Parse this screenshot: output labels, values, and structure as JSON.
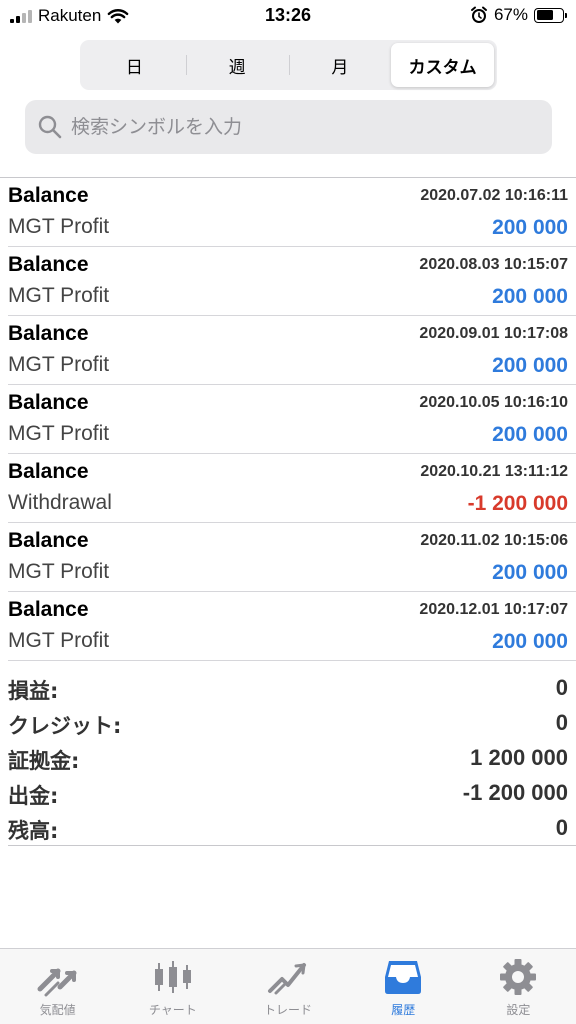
{
  "status_bar": {
    "carrier": "Rakuten",
    "time": "13:26",
    "battery_percent": "67%",
    "battery_level": 0.67
  },
  "period_tabs": [
    {
      "label": "日",
      "active": false
    },
    {
      "label": "週",
      "active": false
    },
    {
      "label": "月",
      "active": false
    },
    {
      "label": "カスタム",
      "active": true
    }
  ],
  "search": {
    "placeholder": "検索シンボルを入力",
    "value": ""
  },
  "deals": [
    {
      "type": "Balance",
      "time": "2020.07.02 10:16:11",
      "comment": "MGT Profit",
      "amount": "200 000",
      "sign": "positive"
    },
    {
      "type": "Balance",
      "time": "2020.08.03 10:15:07",
      "comment": "MGT Profit",
      "amount": "200 000",
      "sign": "positive"
    },
    {
      "type": "Balance",
      "time": "2020.09.01 10:17:08",
      "comment": "MGT Profit",
      "amount": "200 000",
      "sign": "positive"
    },
    {
      "type": "Balance",
      "time": "2020.10.05 10:16:10",
      "comment": "MGT Profit",
      "amount": "200 000",
      "sign": "positive"
    },
    {
      "type": "Balance",
      "time": "2020.10.21 13:11:12",
      "comment": "Withdrawal",
      "amount": "-1 200 000",
      "sign": "negative"
    },
    {
      "type": "Balance",
      "time": "2020.11.02 10:15:06",
      "comment": "MGT Profit",
      "amount": "200 000",
      "sign": "positive"
    },
    {
      "type": "Balance",
      "time": "2020.12.01 10:17:07",
      "comment": "MGT Profit",
      "amount": "200 000",
      "sign": "positive"
    }
  ],
  "summary": [
    {
      "label": "損益:",
      "value": "0"
    },
    {
      "label": "クレジット:",
      "value": "0"
    },
    {
      "label": "証拠金:",
      "value": "1 200 000"
    },
    {
      "label": "出金:",
      "value": "-1 200 000"
    },
    {
      "label": "残高:",
      "value": "0"
    }
  ],
  "tab_bar": [
    {
      "label": "気配値",
      "icon": "quotes-icon",
      "active": false
    },
    {
      "label": "チャート",
      "icon": "chart-icon",
      "active": false
    },
    {
      "label": "トレード",
      "icon": "trade-icon",
      "active": false
    },
    {
      "label": "履歴",
      "icon": "history-icon",
      "active": true
    },
    {
      "label": "設定",
      "icon": "settings-icon",
      "active": false
    }
  ],
  "colors": {
    "accent": "#2f7bdc",
    "negative": "#d83a2b",
    "inactive_tab": "#8e8e93"
  }
}
